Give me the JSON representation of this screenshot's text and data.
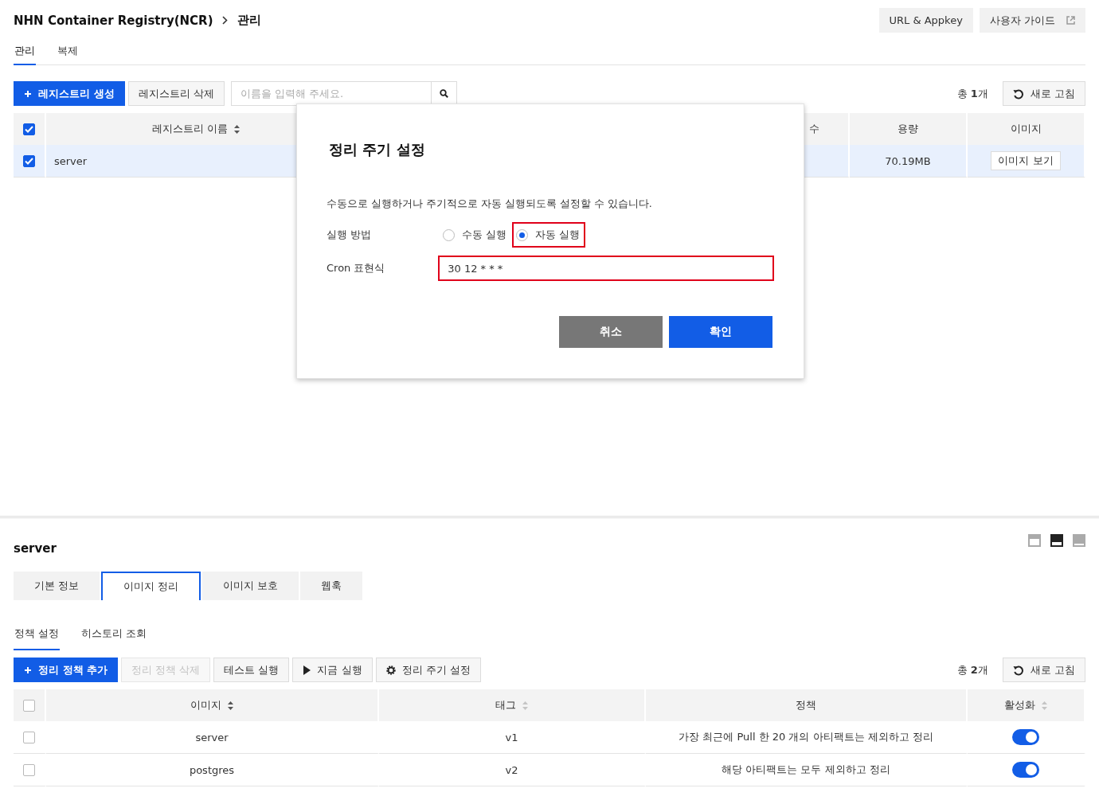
{
  "breadcrumb": {
    "service": "NHN Container Registry(NCR)",
    "page": "관리"
  },
  "header_buttons": [
    {
      "label": "URL & Appkey",
      "kind": "plain"
    },
    {
      "label": "사용자 가이드",
      "kind": "external"
    }
  ],
  "tabs": [
    {
      "label": "관리",
      "selected": true
    },
    {
      "label": "복제",
      "selected": false
    }
  ],
  "toolbar": {
    "buttons": [
      {
        "label": "레지스트리 생성",
        "kind": "create",
        "disabled": false
      },
      {
        "label": "레지스트리 삭제",
        "kind": "delete",
        "disabled": false
      }
    ],
    "search": {
      "placeholder": "이름을 입력해 주세요."
    },
    "total": "총 **1**개",
    "refresh": "새로 고침"
  },
  "registry_table": {
    "all_checked": true,
    "columns": [
      {
        "label": "레지스트리 이름",
        "sortable": true,
        "sorted": true
      },
      {
        "label": "수",
        "sortable": false
      },
      {
        "label": "용량",
        "sortable": false
      },
      {
        "label": "이미지",
        "sortable": false
      }
    ],
    "rows": [
      {
        "checked": true,
        "selected": true,
        "name": "server",
        "size": "70.19MB",
        "action": "이미지 보기"
      }
    ]
  },
  "dialog": {
    "title": "정리 주기 설정",
    "description": "수동으로 실행하거나 주기적으로 자동 실행되도록 설정할 수 있습니다.",
    "method_label": "실행 방법",
    "options": [
      {
        "label": "수동 실행",
        "selected": false,
        "highlighted": false
      },
      {
        "label": "자동 실행",
        "selected": true,
        "highlighted": true
      }
    ],
    "cron_label": "Cron 표현식",
    "cron_value": "30 12 * * *",
    "cron_highlighted": true,
    "buttons": [
      {
        "label": "취소",
        "kind": "secondary"
      },
      {
        "label": "확인",
        "kind": "primary"
      }
    ]
  },
  "detail": {
    "title": "server",
    "layout_buttons": [
      {
        "kind": "top",
        "selected": false
      },
      {
        "kind": "middle",
        "selected": true
      },
      {
        "kind": "bottom",
        "selected": false
      }
    ],
    "tabs": [
      {
        "label": "기본 정보",
        "selected": false
      },
      {
        "label": "이미지 정리",
        "selected": true
      },
      {
        "label": "이미지 보호",
        "selected": false
      },
      {
        "label": "웹훅",
        "selected": false
      }
    ],
    "subtabs": [
      {
        "label": "정책 설정",
        "selected": true
      },
      {
        "label": "히스토리 조회",
        "selected": false
      }
    ],
    "buttons": [
      {
        "label": "정리 정책 추가",
        "kind": "create",
        "disabled": false
      },
      {
        "label": "정리 정책 삭제",
        "kind": "delete",
        "disabled": true
      },
      {
        "label": "테스트 실행",
        "kind": "test",
        "disabled": false
      },
      {
        "label": "지금 실행",
        "kind": "run",
        "disabled": false
      },
      {
        "label": "정리 주기 설정",
        "kind": "schedule",
        "disabled": false
      }
    ],
    "total": "총 **2**개",
    "refresh": "새로 고침",
    "table": {
      "all_checked": false,
      "columns": [
        {
          "label": "이미지",
          "sortable": true,
          "sorted": true
        },
        {
          "label": "태그",
          "sortable": true,
          "sorted": false
        },
        {
          "label": "정책",
          "sortable": false
        },
        {
          "label": "활성화",
          "sortable": true,
          "sorted": false
        }
      ],
      "rows": [
        {
          "checked": false,
          "image": "server",
          "tag": "v1",
          "policy": "가장 최근에 Pull 한 20 개의 아티팩트는 제외하고 정리",
          "enabled": true
        },
        {
          "checked": false,
          "image": "postgres",
          "tag": "v2",
          "policy": "해당 아티팩트는 모두 제외하고 정리",
          "enabled": true
        }
      ]
    }
  }
}
